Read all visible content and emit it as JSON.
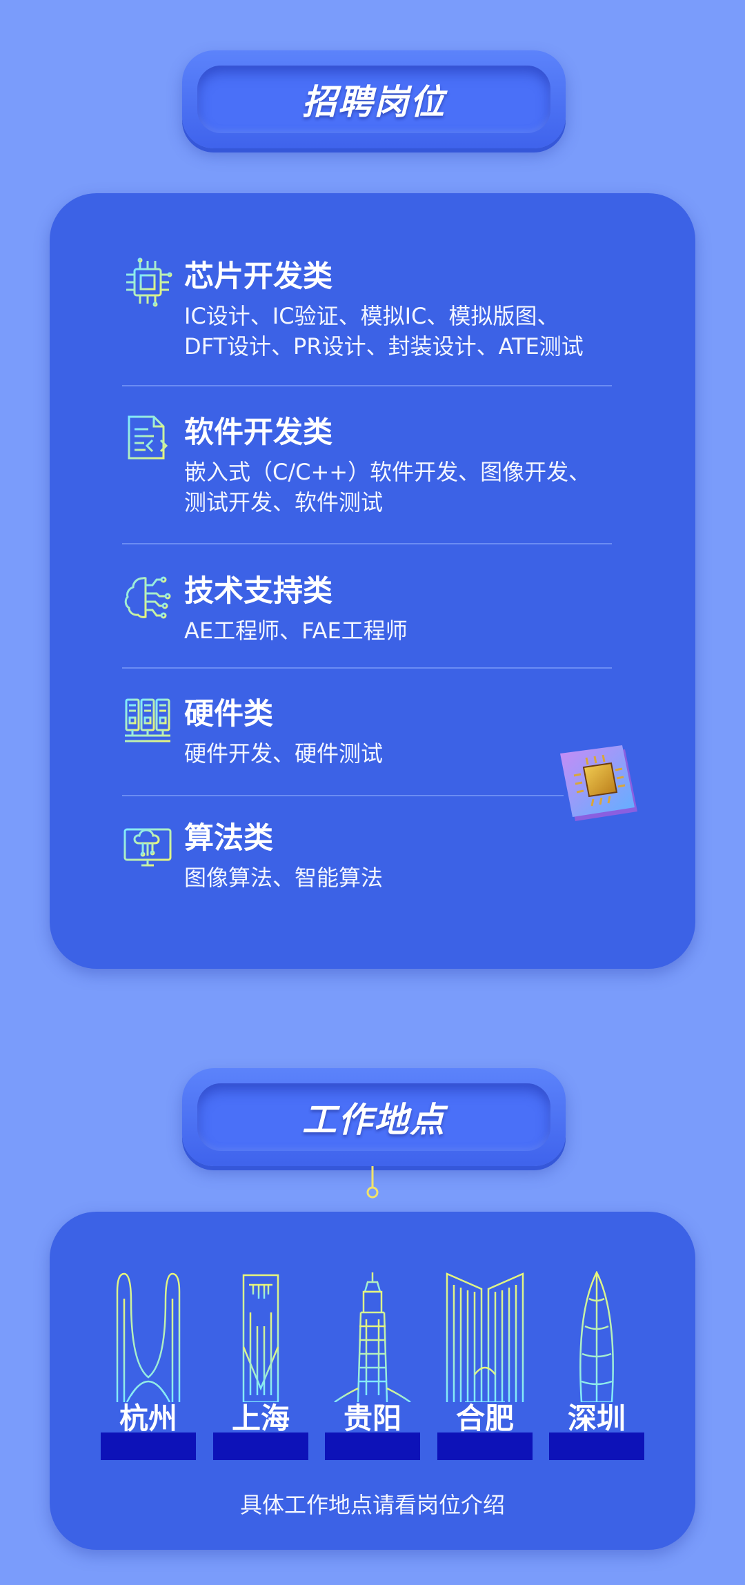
{
  "section_jobs": {
    "title": "招聘岗位",
    "categories": [
      {
        "icon": "chip-icon",
        "title": "芯片开发类",
        "desc": "IC设计、IC验证、模拟IC、模拟版图、\nDFT设计、PR设计、封装设计、ATE测试"
      },
      {
        "icon": "document-code-icon",
        "title": "软件开发类",
        "desc": "嵌入式（C/C++）软件开发、图像开发、\n测试开发、软件测试"
      },
      {
        "icon": "brain-circuit-icon",
        "title": "技术支持类",
        "desc": "AE工程师、FAE工程师"
      },
      {
        "icon": "hardware-board-icon",
        "title": "硬件类",
        "desc": "硬件开发、硬件测试"
      },
      {
        "icon": "cloud-monitor-icon",
        "title": "算法类",
        "desc": "图像算法、智能算法"
      }
    ]
  },
  "section_location": {
    "title": "工作地点",
    "cities": [
      {
        "name": "杭州",
        "icon": "hangzhou-landmark-icon"
      },
      {
        "name": "上海",
        "icon": "shanghai-landmark-icon"
      },
      {
        "name": "贵阳",
        "icon": "guiyang-landmark-icon"
      },
      {
        "name": "合肥",
        "icon": "hefei-landmark-icon"
      },
      {
        "name": "深圳",
        "icon": "shenzhen-landmark-icon"
      }
    ],
    "note": "具体工作地点请看岗位介绍"
  },
  "colors": {
    "background": "#7a9cfb",
    "card": "#3c62e6",
    "icon_gradient_start": "#7fe9ff",
    "icon_gradient_end": "#e8f57a",
    "city_band": "#0d12b8"
  }
}
